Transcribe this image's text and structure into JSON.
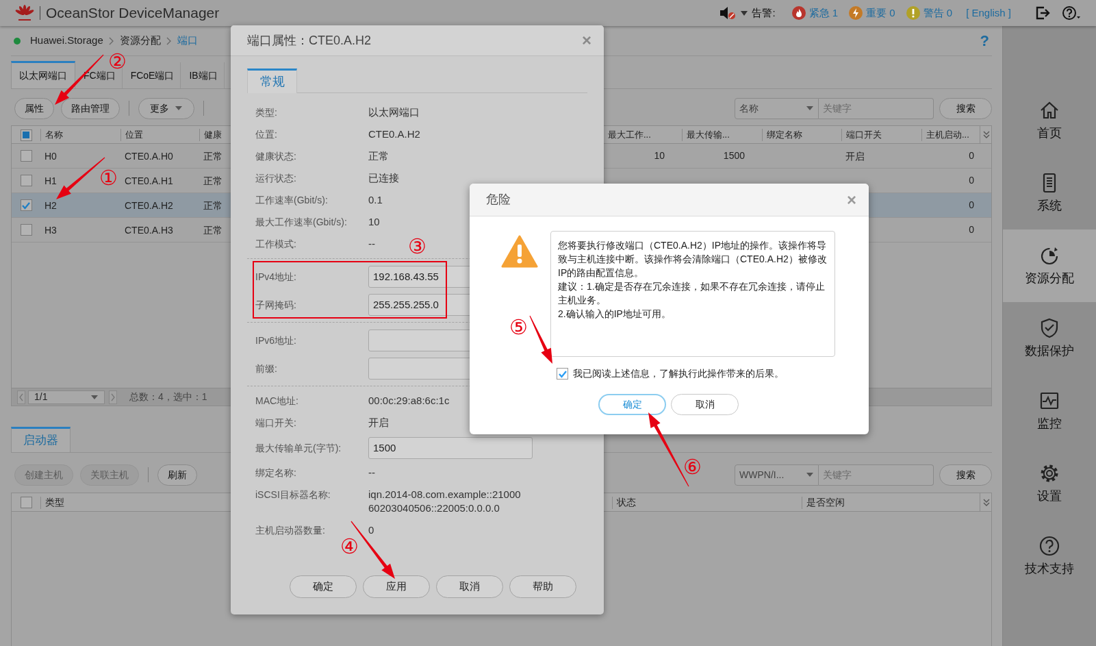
{
  "header": {
    "title": "OceanStor DeviceManager",
    "alarm_label": "告警:",
    "alarms": [
      {
        "kind": "critical",
        "label": "紧急 1",
        "color": "#b8352d"
      },
      {
        "kind": "major",
        "label": "重要 0",
        "color": "#c47a26"
      },
      {
        "kind": "warning",
        "label": "警告 0",
        "color": "#b1a127"
      }
    ],
    "language": "[ English ]"
  },
  "breadcrumb": {
    "items": [
      "Huawei.Storage",
      "资源分配",
      "端口"
    ],
    "help": "?"
  },
  "port_tabs": [
    {
      "label": "以太网端口",
      "selected": true
    },
    {
      "label": "FC端口",
      "selected": false
    },
    {
      "label": "FCoE端口",
      "selected": false
    },
    {
      "label": "IB端口",
      "selected": false
    }
  ],
  "toolbar": [
    {
      "kind": "button",
      "label": "属性"
    },
    {
      "kind": "button",
      "label": "路由管理"
    },
    {
      "kind": "divider"
    },
    {
      "kind": "menu",
      "label": "更多"
    },
    {
      "kind": "divider"
    }
  ],
  "search": {
    "field": "名称",
    "placeholder": "关键字",
    "button": "搜索"
  },
  "table": {
    "select_all": {
      "indeterminate": true
    },
    "columns": [
      "名称",
      "位置",
      "健康",
      "最大工作...",
      "最大传输...",
      "绑定名称",
      "端口开关",
      "主机启动..."
    ],
    "rows": [
      {
        "checked": false,
        "selected": false,
        "cells": [
          "H0",
          "CTE0.A.H0",
          "正常",
          "10",
          "1500",
          null,
          "开启",
          "0"
        ]
      },
      {
        "checked": false,
        "selected": false,
        "cells": [
          "H1",
          "CTE0.A.H1",
          "正常",
          null,
          null,
          null,
          null,
          "0"
        ]
      },
      {
        "checked": true,
        "selected": true,
        "cells": [
          "H2",
          "CTE0.A.H2",
          "正常",
          null,
          null,
          null,
          null,
          "0"
        ]
      },
      {
        "checked": false,
        "selected": false,
        "cells": [
          "H3",
          "CTE0.A.H3",
          "正常",
          null,
          null,
          null,
          null,
          "0"
        ]
      }
    ]
  },
  "pagination": {
    "page": "1/1",
    "summary": "总数：4，选中：1"
  },
  "initiator_panel": {
    "tab": {
      "label": "启动器",
      "selected": true
    },
    "buttons": [
      {
        "label": "创建主机",
        "disabled": true
      },
      {
        "label": "关联主机",
        "disabled": true
      },
      {
        "label": "刷新",
        "disabled": false
      }
    ],
    "search": {
      "field": "WWPN/I...",
      "placeholder": "关键字",
      "button": "搜索"
    },
    "select_all": {
      "checked": false
    },
    "columns": [
      "类型",
      "状态",
      "是否空闲"
    ]
  },
  "sidebar": {
    "items": [
      {
        "kind": "home",
        "label": "首页",
        "selected": false
      },
      {
        "kind": "system",
        "label": "系统",
        "selected": false
      },
      {
        "kind": "resource",
        "label": "资源分配",
        "selected": true
      },
      {
        "kind": "protection",
        "label": "数据保护",
        "selected": false
      },
      {
        "kind": "monitor",
        "label": "监控",
        "selected": false
      },
      {
        "kind": "settings",
        "label": "设置",
        "selected": false
      },
      {
        "kind": "support",
        "label": "技术支持",
        "selected": false
      }
    ]
  },
  "port_dialog": {
    "title": "端口属性：CTE0.A.H2",
    "close": "×",
    "tabs": [
      {
        "label": "常规",
        "selected": true
      }
    ],
    "sections": [
      [
        {
          "kind": "text",
          "label": "类型:",
          "value": "以太网端口"
        },
        {
          "kind": "text",
          "label": "位置:",
          "value": "CTE0.A.H2"
        },
        {
          "kind": "text",
          "label": "健康状态:",
          "value": "正常"
        },
        {
          "kind": "text",
          "label": "运行状态:",
          "value": "已连接"
        },
        {
          "kind": "text",
          "label": "工作速率(Gbit/s):",
          "value": "0.1"
        },
        {
          "kind": "text",
          "label": "最大工作速率(Gbit/s):",
          "value": "10"
        },
        {
          "kind": "text",
          "label": "工作模式:",
          "value": "--"
        }
      ],
      [
        {
          "kind": "input",
          "label": "IPv4地址:",
          "value": "192.168.43.55"
        },
        {
          "kind": "input",
          "label": "子网掩码:",
          "value": "255.255.255.0"
        }
      ],
      [
        {
          "kind": "input",
          "label": "IPv6地址:"
        },
        {
          "kind": "input",
          "label": "前缀:"
        }
      ],
      [
        {
          "kind": "text",
          "label": "MAC地址:",
          "value": "00:0c:29:a8:6c:1c"
        },
        {
          "kind": "text",
          "label": "端口开关:",
          "value": "开启"
        },
        {
          "kind": "input",
          "label": "最大传输单元(字节):",
          "value": "1500"
        },
        {
          "kind": "text",
          "label": "绑定名称:",
          "value": "--"
        },
        {
          "kind": "text",
          "label": "iSCSI目标器名称:",
          "value": "iqn.2014-08.com.example::2100060203040506::22005:0.0.0.0"
        },
        {
          "kind": "text",
          "label": "主机启动器数量:",
          "value": "0"
        }
      ]
    ],
    "buttons": [
      "确定",
      "应用",
      "取消",
      "帮助"
    ]
  },
  "danger_dialog": {
    "title": "危险",
    "close": "×",
    "message": [
      "您将要执行修改端口（CTE0.A.H2）IP地址的操作。该操作将导致与主机连接中断。该操作将会清除端口（CTE0.A.H2）被修改IP的路由配置信息。",
      "建议：1.确定是否存在冗余连接，如果不存在冗余连接，请停止主机业务。",
      "2.确认输入的IP地址可用。"
    ],
    "acknowledge": {
      "label": "我已阅读上述信息，了解执行此操作带来的后果。",
      "checked": true
    },
    "buttons": [
      {
        "label": "确定",
        "primary": true
      },
      {
        "label": "取消",
        "primary": false
      }
    ]
  },
  "annotations": [
    {
      "label": "①"
    },
    {
      "label": "②"
    },
    {
      "label": "③"
    },
    {
      "label": "④"
    },
    {
      "label": "⑤"
    },
    {
      "label": "⑥"
    }
  ]
}
